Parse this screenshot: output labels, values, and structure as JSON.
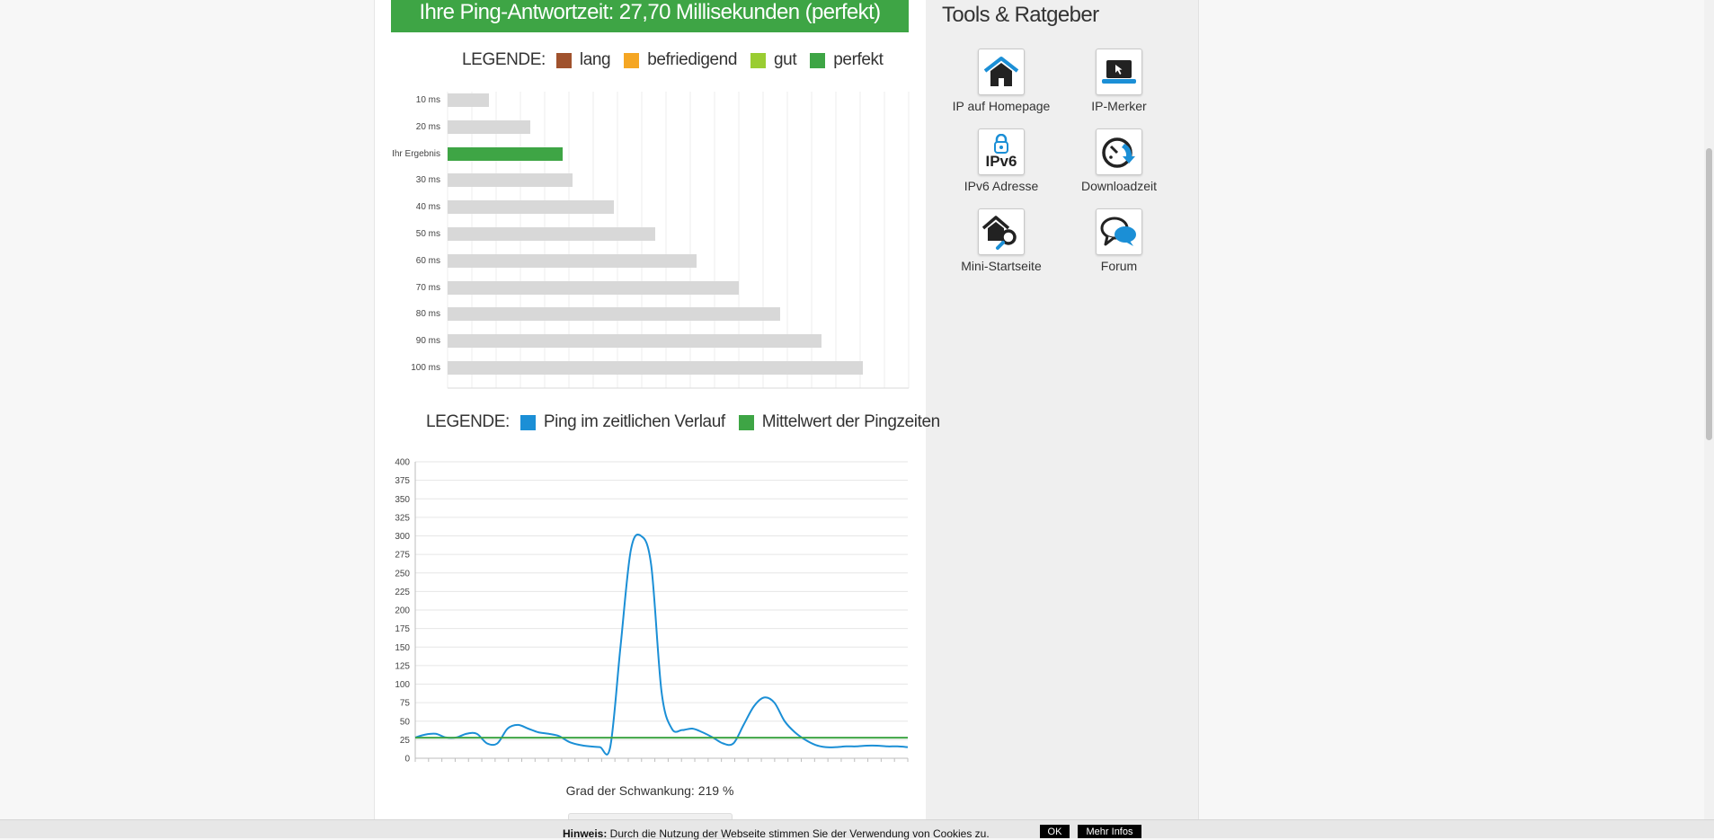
{
  "banner": {
    "text": "Ihre Ping-Antwortzeit: 27,70 Millisekunden (perfekt)"
  },
  "legend1": {
    "title": "LEGENDE:",
    "items": [
      {
        "label": "lang",
        "color": "#a0522d"
      },
      {
        "label": "befriedigend",
        "color": "#f5a623"
      },
      {
        "label": "gut",
        "color": "#9acd32"
      },
      {
        "label": "perfekt",
        "color": "#3ea545"
      }
    ]
  },
  "legend2": {
    "title": "LEGENDE:",
    "items": [
      {
        "label": "Ping im zeitlichen Verlauf",
        "color": "#1b8fd6"
      },
      {
        "label": "Mittelwert der Pingzeiten",
        "color": "#3ea545"
      }
    ]
  },
  "chart_data": [
    {
      "type": "bar",
      "orientation": "horizontal",
      "categories": [
        "10 ms",
        "20 ms",
        "Ihr Ergebnis",
        "30 ms",
        "40 ms",
        "50 ms",
        "60 ms",
        "70 ms",
        "80 ms",
        "90 ms",
        "100 ms"
      ],
      "values": [
        10,
        20,
        27.7,
        30,
        40,
        50,
        60,
        70,
        80,
        90,
        100
      ],
      "bar_colors": [
        "#d8d8d8",
        "#d8d8d8",
        "#3ea545",
        "#d8d8d8",
        "#d8d8d8",
        "#d8d8d8",
        "#d8d8d8",
        "#d8d8d8",
        "#d8d8d8",
        "#d8d8d8",
        "#d8d8d8"
      ],
      "xlim": [
        0,
        111
      ],
      "grid": true
    },
    {
      "type": "line",
      "yticks": [
        0,
        25,
        50,
        75,
        100,
        125,
        150,
        175,
        200,
        225,
        250,
        275,
        300,
        325,
        350,
        375,
        400
      ],
      "ylim": [
        0,
        400
      ],
      "x": [
        0,
        1,
        2,
        3,
        4,
        5,
        6,
        7,
        8,
        9,
        10,
        11,
        12,
        13,
        14,
        15,
        16,
        17,
        18,
        19,
        20,
        21,
        22,
        23,
        24,
        25,
        26,
        27,
        28,
        29,
        30,
        31,
        32,
        33,
        34,
        35,
        36,
        37,
        38,
        39,
        40,
        41,
        42,
        43,
        44,
        45,
        46,
        47,
        48,
        49,
        50,
        51,
        52,
        53,
        54,
        55,
        56,
        57,
        58,
        59,
        60,
        61,
        62,
        63,
        64,
        65,
        66,
        67,
        68,
        69,
        70,
        71,
        72,
        73,
        74,
        75,
        76,
        77,
        78,
        79,
        80,
        81,
        82,
        83,
        84,
        85,
        86,
        87,
        88,
        89,
        90,
        91,
        92,
        93,
        94,
        95,
        96,
        97,
        98,
        99,
        100,
        101,
        102,
        103,
        104,
        105,
        106,
        107,
        108,
        109,
        110,
        111,
        112,
        113,
        114,
        115,
        116,
        117,
        118,
        119,
        120,
        121,
        122,
        123,
        124,
        125,
        126,
        127,
        128,
        129,
        130,
        131,
        132,
        133,
        134,
        135,
        136,
        137,
        138,
        139,
        140,
        141,
        142,
        143,
        144,
        145,
        146,
        147,
        148,
        149,
        150,
        151,
        152,
        153,
        154,
        155,
        156,
        157,
        158,
        159,
        160,
        161,
        162,
        163,
        164,
        165,
        166,
        167,
        168,
        169,
        170,
        171,
        172,
        173,
        174,
        175,
        176,
        177,
        178,
        179,
        180,
        181,
        182,
        183,
        184,
        185,
        186,
        187,
        188,
        189,
        190,
        191,
        192,
        193,
        194,
        195,
        196,
        197,
        198,
        199,
        200,
        201,
        202,
        203,
        204,
        205,
        206,
        207,
        208,
        209,
        210,
        211,
        212,
        213,
        214,
        215,
        216,
        217,
        218,
        219,
        220,
        221,
        222,
        223,
        224,
        225,
        226,
        227,
        228,
        229,
        230,
        231,
        232,
        233,
        234,
        235,
        236,
        237,
        238,
        239,
        240,
        241,
        242,
        243,
        244,
        245,
        246,
        247,
        248,
        249,
        250,
        251,
        252,
        253,
        254,
        255,
        256,
        257,
        258,
        259,
        260,
        261,
        262,
        263,
        264,
        265,
        266,
        267,
        268,
        269,
        270,
        271,
        272,
        273,
        274,
        275,
        276,
        277,
        278,
        279,
        280,
        281,
        282,
        283,
        284,
        285,
        286,
        287,
        288,
        289,
        290,
        291,
        292,
        293,
        294,
        295,
        296,
        297,
        298,
        299,
        300,
        301,
        302,
        303,
        304,
        305,
        306,
        307,
        308,
        309,
        310,
        311,
        312,
        313,
        314,
        315,
        316,
        317,
        318,
        319,
        320,
        321,
        322,
        323,
        324,
        325,
        326,
        327,
        328,
        329,
        330,
        331,
        332,
        333,
        334,
        335,
        336,
        337,
        338,
        339,
        340,
        341,
        342,
        343,
        344,
        345,
        346,
        347,
        348,
        349,
        350,
        351,
        352,
        353,
        354,
        355,
        356,
        357,
        358,
        359,
        360,
        361,
        362,
        363,
        364,
        365,
        366,
        367,
        368,
        369,
        370,
        371,
        372,
        373,
        374,
        375,
        376,
        377,
        378,
        379,
        380,
        381,
        382,
        383,
        384,
        385,
        386,
        387,
        388,
        389,
        390,
        391,
        392,
        393,
        394,
        395,
        396,
        397,
        398,
        399,
        400,
        401,
        402,
        403,
        404,
        405,
        406,
        407,
        408,
        409,
        410,
        411,
        412,
        413,
        414,
        415,
        416,
        417,
        418,
        419,
        420,
        421,
        422,
        423,
        424,
        425,
        426,
        427,
        428,
        429,
        430,
        431,
        432,
        433,
        434,
        435,
        436,
        437,
        438,
        439,
        440,
        441,
        442,
        443,
        444,
        445,
        446,
        447,
        448,
        449,
        450,
        451,
        452,
        453,
        454,
        455,
        456,
        457,
        458,
        459,
        460,
        461,
        462,
        463,
        464,
        465,
        466,
        467,
        468,
        469,
        470,
        471,
        472,
        473,
        474,
        475,
        476,
        477,
        478,
        479,
        480,
        481,
        482,
        483,
        484,
        485,
        486,
        487,
        488,
        489,
        490,
        491,
        492,
        493,
        494,
        495,
        496,
        497,
        498,
        499,
        500,
        501,
        502,
        503,
        504,
        505,
        506,
        507,
        508,
        509,
        510,
        511,
        512,
        513,
        514,
        515,
        516,
        517,
        518,
        519,
        520,
        521,
        522,
        523,
        524,
        525,
        526,
        527,
        528,
        529,
        530,
        531,
        532,
        533,
        534,
        535,
        536,
        537,
        538,
        539,
        540,
        541,
        542,
        543,
        544,
        545,
        546,
        547,
        548,
        549
      ],
      "series": [
        {
          "name": "Ping im zeitlichen Verlauf",
          "color": "#1b8fd6",
          "values": [
            28,
            32,
            33,
            28,
            28,
            33,
            33,
            20,
            20,
            40,
            45,
            40,
            35,
            33,
            30,
            22,
            18,
            16,
            15,
            15,
            150,
            280,
            300,
            260,
            90,
            40,
            38,
            40,
            35,
            28,
            20,
            20,
            45,
            70,
            82,
            75,
            50,
            35,
            25,
            18,
            15,
            15,
            16,
            16,
            17,
            17,
            16,
            16,
            15
          ]
        },
        {
          "name": "Mittelwert der Pingzeiten",
          "color": "#3ea545",
          "values": [
            27.7
          ]
        }
      ]
    }
  ],
  "stat": {
    "text": "Grad der Schwankung: 219 %"
  },
  "sidebar": {
    "title": "Tools & Ratgeber",
    "tools": [
      {
        "label": "IP auf Homepage"
      },
      {
        "label": "IP-Merker"
      },
      {
        "label": "IPv6 Adresse",
        "icon_text": "IPv6"
      },
      {
        "label": "Downloadzeit"
      },
      {
        "label": "Mini-Startseite"
      },
      {
        "label": "Forum"
      }
    ]
  },
  "cookie": {
    "prefix": "Hinweis:",
    "text": " Durch die Nutzung der Webseite stimmen Sie der Verwendung von Cookies zu.",
    "ok_label": "OK",
    "more_label": "Mehr Infos"
  }
}
